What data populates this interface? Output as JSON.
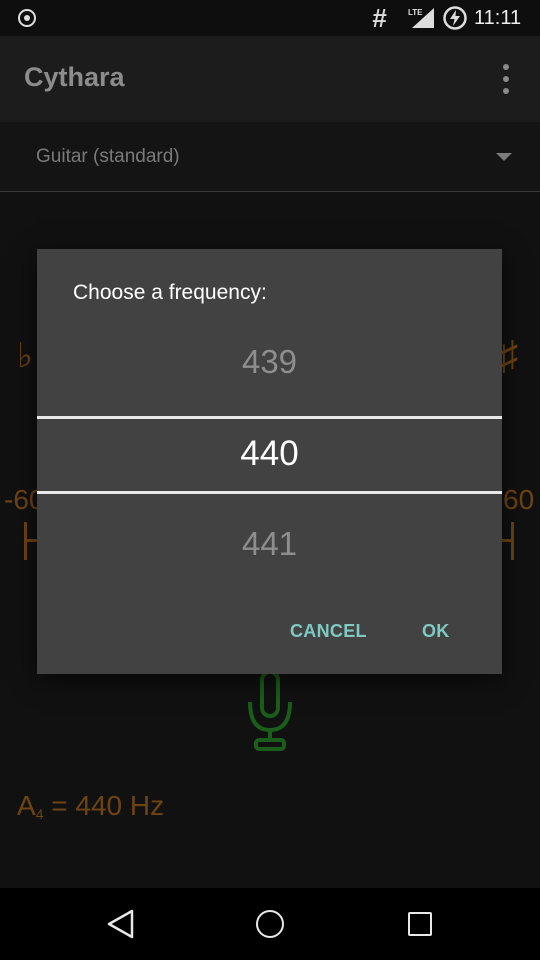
{
  "status_bar": {
    "time": "11:11",
    "network_label": "LTE",
    "hash_symbol": "#"
  },
  "app": {
    "title": "Cythara"
  },
  "tuning_selector": {
    "selected": "Guitar (standard)"
  },
  "tuner": {
    "flat_symbol": "♭",
    "sharp_symbol": "♯",
    "cents_min": "-60",
    "cents_max": "60",
    "reference_note": "A",
    "reference_octave": "4",
    "reference_value": " = 440 Hz"
  },
  "dialog": {
    "title": "Choose a frequency:",
    "previous_value": "439",
    "current_value": "440",
    "next_value": "441",
    "cancel_label": "CANCEL",
    "ok_label": "OK"
  },
  "colors": {
    "accent_button": "#7ec9c2",
    "tuner_orange": "#6e4412",
    "mic_green": "#1a5e1a"
  }
}
